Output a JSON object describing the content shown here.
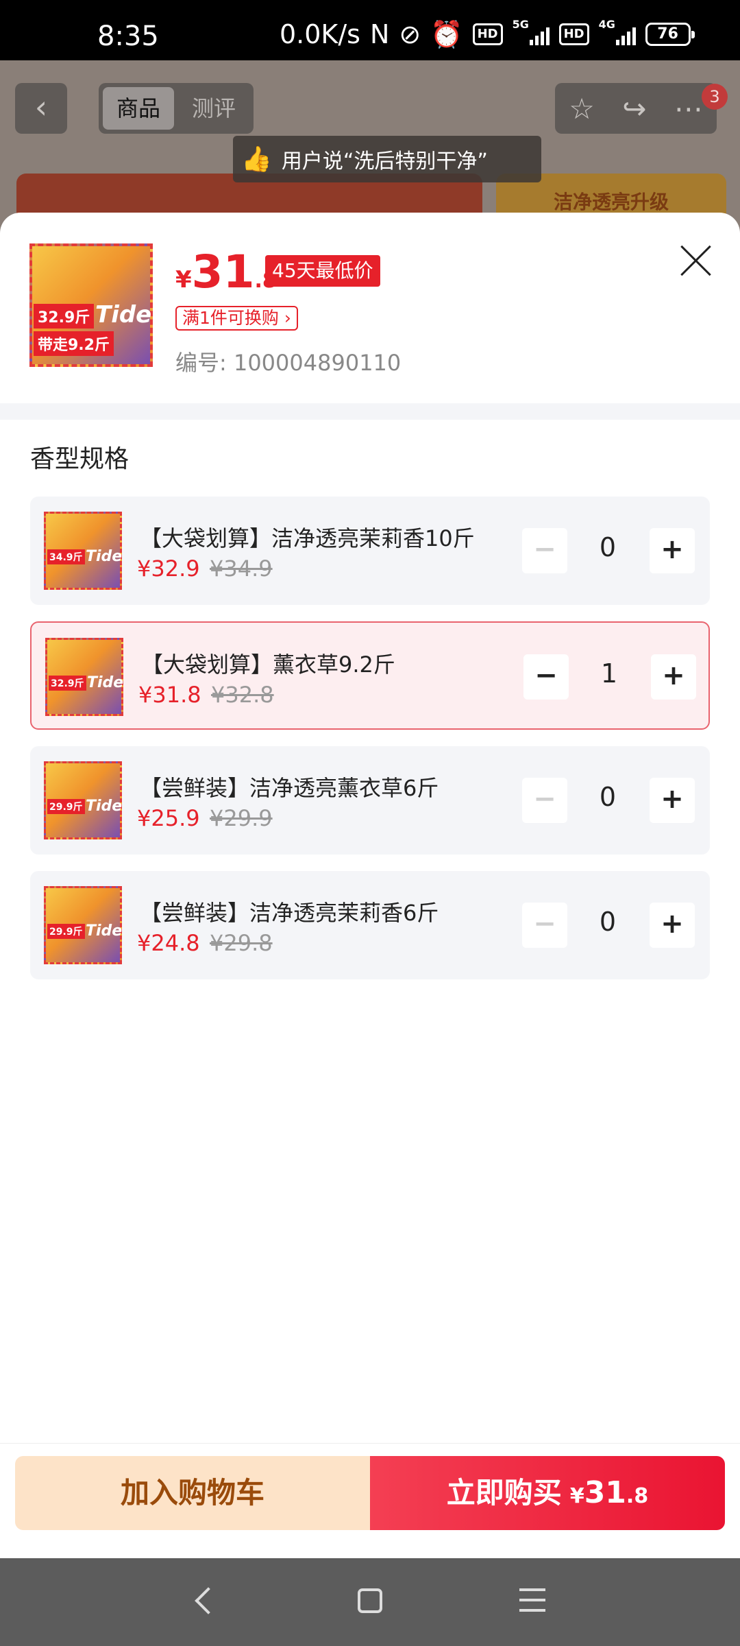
{
  "status_bar": {
    "time": "8:35",
    "speed": "0.0K/s",
    "hd1": "HD",
    "net1": "5G",
    "hd2": "HD",
    "net2": "4G",
    "battery": "76"
  },
  "background": {
    "tab_goods": "商品",
    "tab_review": "测评",
    "cart_badge": "3",
    "toast": "用户说“洗后特别干净”",
    "banner_right": "洁净透亮升级"
  },
  "product": {
    "price_currency": "¥",
    "price_int": "31",
    "price_dec": ".8",
    "low_badge": "45天最低价",
    "swap_label": "满1件可换购 ›",
    "sku_number": "编号: 100004890110",
    "image": {
      "brand": "Tide",
      "tag1": "32.9斤",
      "tag2": "带走9.2斤"
    }
  },
  "spec_section": {
    "title": "香型规格",
    "options": [
      {
        "title": "【大袋划算】洁净透亮茉莉香10斤",
        "price": "¥32.9",
        "orig": "¥34.9",
        "qty": "0",
        "tag": "34.9斤",
        "selected": false
      },
      {
        "title": "【大袋划算】薰衣草9.2斤",
        "price": "¥31.8",
        "orig": "¥32.8",
        "qty": "1",
        "tag": "32.9斤",
        "selected": true
      },
      {
        "title": "【尝鲜装】洁净透亮薰衣草6斤",
        "price": "¥25.9",
        "orig": "¥29.9",
        "qty": "0",
        "tag": "29.9斤",
        "selected": false
      },
      {
        "title": "【尝鲜装】洁净透亮茉莉香6斤",
        "price": "¥24.8",
        "orig": "¥29.8",
        "qty": "0",
        "tag": "29.9斤",
        "selected": false
      }
    ],
    "minus": "−",
    "plus": "+"
  },
  "bottom": {
    "cart_label": "加入购物车",
    "buy_label": "立即购买",
    "buy_currency": "¥",
    "buy_int": "31",
    "buy_dec": ".8"
  },
  "colors": {
    "accent": "#e6212a",
    "cart_bg": "#fde3c8",
    "cart_text": "#9a4b0b"
  },
  "icons": [
    "back-icon",
    "star-icon",
    "share-icon",
    "more-icon",
    "thumbs-up-icon",
    "close-icon",
    "nav-back-icon",
    "nav-home-icon",
    "nav-menu-icon"
  ]
}
